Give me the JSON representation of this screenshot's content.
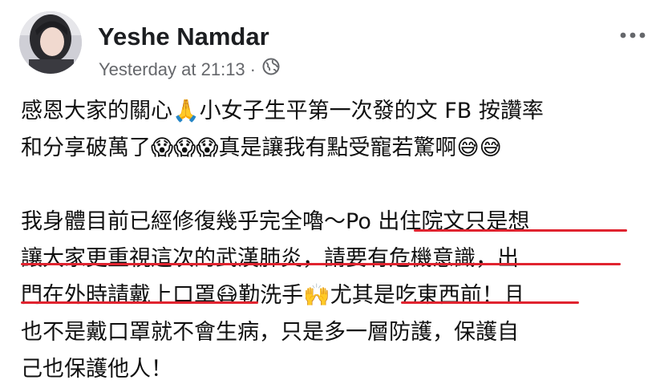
{
  "post": {
    "author": "Yeshe Namdar",
    "timestamp": "Yesterday at 21:13",
    "separator": "·",
    "privacy_icon": "globe-icon",
    "more_icon": "more-options-icon",
    "lines": [
      "感恩大家的關心🙏小女子生平第一次發的文 FB 按讚率",
      "和分享破萬了😱😱😱真是讓我有點受寵若驚啊😅😅",
      "",
      "我身體目前已經修復幾乎完全嚕～Po 出住院文只是想",
      "讓大家更重視這次的武漢肺炎，請要有危機意識，出",
      "門在外時請戴上口罩😷勤洗手🙌尤其是吃東西前！且",
      "也不是戴口罩就不會生病，只是多一層防護，保護自",
      "己也保護他人！"
    ],
    "underline_color": "#e0232f"
  }
}
